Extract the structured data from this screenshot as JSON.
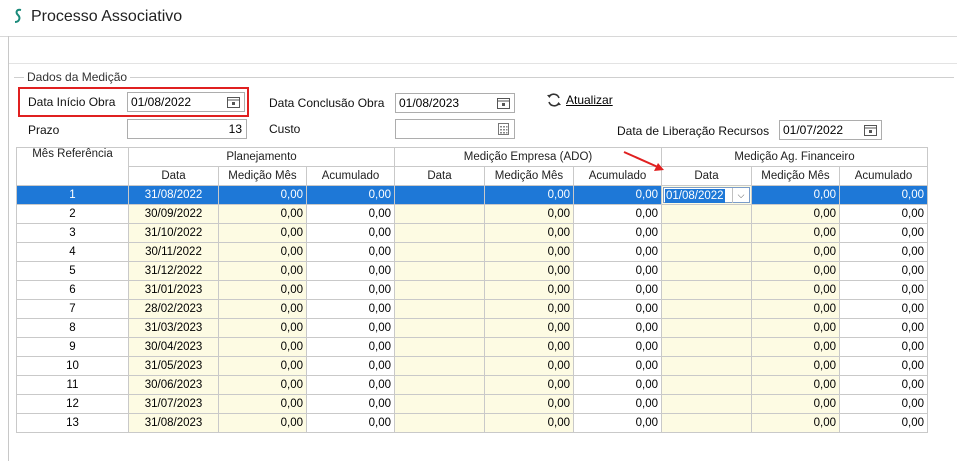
{
  "window": {
    "title": "Processo Associativo"
  },
  "group": {
    "legend": "Dados da Medição"
  },
  "fields": {
    "data_inicio_obra": {
      "label": "Data Início Obra",
      "value": "01/08/2022"
    },
    "data_conclusao_obra": {
      "label": "Data Conclusão Obra",
      "value": "01/08/2023"
    },
    "prazo": {
      "label": "Prazo",
      "value": "13"
    },
    "custo": {
      "label": "Custo",
      "value": ""
    },
    "data_liberacao": {
      "label": "Data de Liberação Recursos",
      "value": "01/07/2022"
    }
  },
  "actions": {
    "atualizar": "Atualizar"
  },
  "colors": {
    "selection": "#1e78d7",
    "highlight_border": "#e02020",
    "editable_cell": "#fdfbe3"
  },
  "table": {
    "groups": {
      "mes_ref": "Mês Referência",
      "planejamento": "Planejamento",
      "medicao_empresa": "Medição Empresa (ADO)",
      "medicao_ag": "Medição Ag. Financeiro"
    },
    "subheaders": {
      "data": "Data",
      "medicao_mes": "Medição Mês",
      "acumulado": "Acumulado"
    },
    "selected_row": 0,
    "rows": [
      {
        "mes": "1",
        "plan_data": "31/08/2022",
        "plan_med": "0,00",
        "plan_acum": "0,00",
        "emp_data": "",
        "emp_med": "0,00",
        "emp_acum": "0,00",
        "ag_data": "01/08/2022",
        "ag_med": "0,00",
        "ag_acum": "0,00"
      },
      {
        "mes": "2",
        "plan_data": "30/09/2022",
        "plan_med": "0,00",
        "plan_acum": "0,00",
        "emp_data": "",
        "emp_med": "0,00",
        "emp_acum": "0,00",
        "ag_data": "",
        "ag_med": "0,00",
        "ag_acum": "0,00"
      },
      {
        "mes": "3",
        "plan_data": "31/10/2022",
        "plan_med": "0,00",
        "plan_acum": "0,00",
        "emp_data": "",
        "emp_med": "0,00",
        "emp_acum": "0,00",
        "ag_data": "",
        "ag_med": "0,00",
        "ag_acum": "0,00"
      },
      {
        "mes": "4",
        "plan_data": "30/11/2022",
        "plan_med": "0,00",
        "plan_acum": "0,00",
        "emp_data": "",
        "emp_med": "0,00",
        "emp_acum": "0,00",
        "ag_data": "",
        "ag_med": "0,00",
        "ag_acum": "0,00"
      },
      {
        "mes": "5",
        "plan_data": "31/12/2022",
        "plan_med": "0,00",
        "plan_acum": "0,00",
        "emp_data": "",
        "emp_med": "0,00",
        "emp_acum": "0,00",
        "ag_data": "",
        "ag_med": "0,00",
        "ag_acum": "0,00"
      },
      {
        "mes": "6",
        "plan_data": "31/01/2023",
        "plan_med": "0,00",
        "plan_acum": "0,00",
        "emp_data": "",
        "emp_med": "0,00",
        "emp_acum": "0,00",
        "ag_data": "",
        "ag_med": "0,00",
        "ag_acum": "0,00"
      },
      {
        "mes": "7",
        "plan_data": "28/02/2023",
        "plan_med": "0,00",
        "plan_acum": "0,00",
        "emp_data": "",
        "emp_med": "0,00",
        "emp_acum": "0,00",
        "ag_data": "",
        "ag_med": "0,00",
        "ag_acum": "0,00"
      },
      {
        "mes": "8",
        "plan_data": "31/03/2023",
        "plan_med": "0,00",
        "plan_acum": "0,00",
        "emp_data": "",
        "emp_med": "0,00",
        "emp_acum": "0,00",
        "ag_data": "",
        "ag_med": "0,00",
        "ag_acum": "0,00"
      },
      {
        "mes": "9",
        "plan_data": "30/04/2023",
        "plan_med": "0,00",
        "plan_acum": "0,00",
        "emp_data": "",
        "emp_med": "0,00",
        "emp_acum": "0,00",
        "ag_data": "",
        "ag_med": "0,00",
        "ag_acum": "0,00"
      },
      {
        "mes": "10",
        "plan_data": "31/05/2023",
        "plan_med": "0,00",
        "plan_acum": "0,00",
        "emp_data": "",
        "emp_med": "0,00",
        "emp_acum": "0,00",
        "ag_data": "",
        "ag_med": "0,00",
        "ag_acum": "0,00"
      },
      {
        "mes": "11",
        "plan_data": "30/06/2023",
        "plan_med": "0,00",
        "plan_acum": "0,00",
        "emp_data": "",
        "emp_med": "0,00",
        "emp_acum": "0,00",
        "ag_data": "",
        "ag_med": "0,00",
        "ag_acum": "0,00"
      },
      {
        "mes": "12",
        "plan_data": "31/07/2023",
        "plan_med": "0,00",
        "plan_acum": "0,00",
        "emp_data": "",
        "emp_med": "0,00",
        "emp_acum": "0,00",
        "ag_data": "",
        "ag_med": "0,00",
        "ag_acum": "0,00"
      },
      {
        "mes": "13",
        "plan_data": "31/08/2023",
        "plan_med": "0,00",
        "plan_acum": "0,00",
        "emp_data": "",
        "emp_med": "0,00",
        "emp_acum": "0,00",
        "ag_data": "",
        "ag_med": "0,00",
        "ag_acum": "0,00"
      }
    ]
  }
}
